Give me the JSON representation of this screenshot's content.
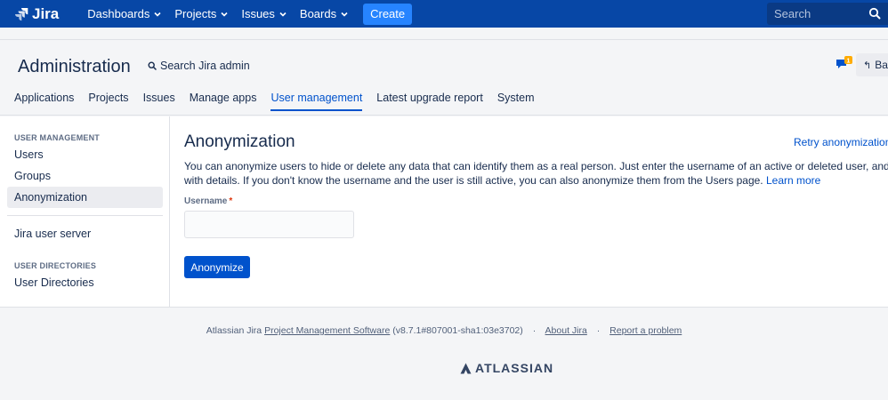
{
  "topnav": {
    "logo_text": "Jira",
    "items": [
      {
        "label": "Dashboards"
      },
      {
        "label": "Projects"
      },
      {
        "label": "Issues"
      },
      {
        "label": "Boards"
      }
    ],
    "create_label": "Create",
    "search_placeholder": "Search"
  },
  "header": {
    "title": "Administration",
    "admin_search_label": "Search Jira admin",
    "notification_count": "1",
    "back_label": "Bac",
    "tabs": [
      {
        "label": "Applications"
      },
      {
        "label": "Projects"
      },
      {
        "label": "Issues"
      },
      {
        "label": "Manage apps"
      },
      {
        "label": "User management"
      },
      {
        "label": "Latest upgrade report"
      },
      {
        "label": "System"
      }
    ],
    "active_tab": "User management"
  },
  "sidebar": {
    "section1_heading": "USER MANAGEMENT",
    "items": [
      {
        "label": "Users"
      },
      {
        "label": "Groups"
      },
      {
        "label": "Anonymization"
      }
    ],
    "selected": "Anonymization",
    "extra_item": "Jira user server",
    "section2_heading": "USER DIRECTORIES",
    "section2_items": [
      {
        "label": "User Directories"
      }
    ]
  },
  "content": {
    "title": "Anonymization",
    "retry_link": "Retry anonymization",
    "description_line1": "You can anonymize users to hide or delete any data that can identify them as a real person. Just enter the username of an active or deleted user, and we'll",
    "description_line2": "with details. If you don't know the username and the user is still active, you can also anonymize them from the Users page.",
    "learn_more": "Learn more",
    "username_label": "Username",
    "required_mark": "*",
    "username_value": "",
    "submit_label": "Anonymize"
  },
  "footer": {
    "prefix": "Atlassian Jira",
    "product_link": "Project Management Software",
    "version": "(v8.7.1#807001-sha1:03e3702)",
    "about_link": "About Jira",
    "report_link": "Report a problem",
    "brand": "ATLASSIAN"
  },
  "colors": {
    "nav_bg": "#0747a6",
    "create_bg": "#2684ff",
    "link": "#0052cc",
    "primary_button": "#0052cc",
    "notification_badge": "#ffab00"
  }
}
